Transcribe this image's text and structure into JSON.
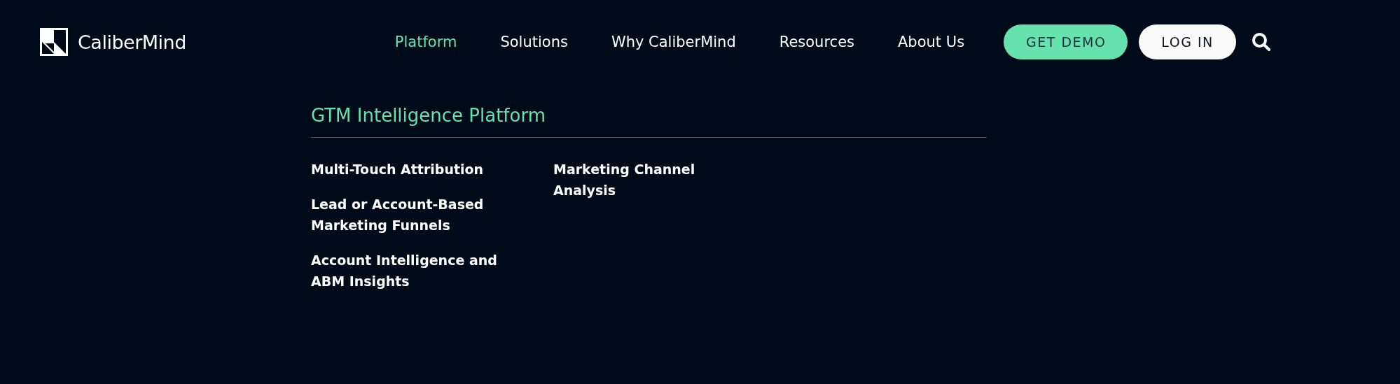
{
  "logo": {
    "text": "CaliberMind"
  },
  "nav": [
    {
      "label": "Platform",
      "selected": true
    },
    {
      "label": "Solutions",
      "selected": false
    },
    {
      "label": "Why CaliberMind",
      "selected": false
    },
    {
      "label": "Resources",
      "selected": false
    },
    {
      "label": "About Us",
      "selected": false
    }
  ],
  "buttons": [
    {
      "label": "GET DEMO",
      "kind": "primary"
    },
    {
      "label": "LOG IN",
      "kind": "secondary"
    }
  ],
  "menu": {
    "heading": "GTM Intelligence Platform",
    "columns": [
      [
        "Multi-Touch Attribution",
        "Lead or Account-Based Marketing Funnels",
        "Account Intelligence and ABM Insights"
      ],
      [
        "Marketing Channel Analysis"
      ]
    ]
  }
}
